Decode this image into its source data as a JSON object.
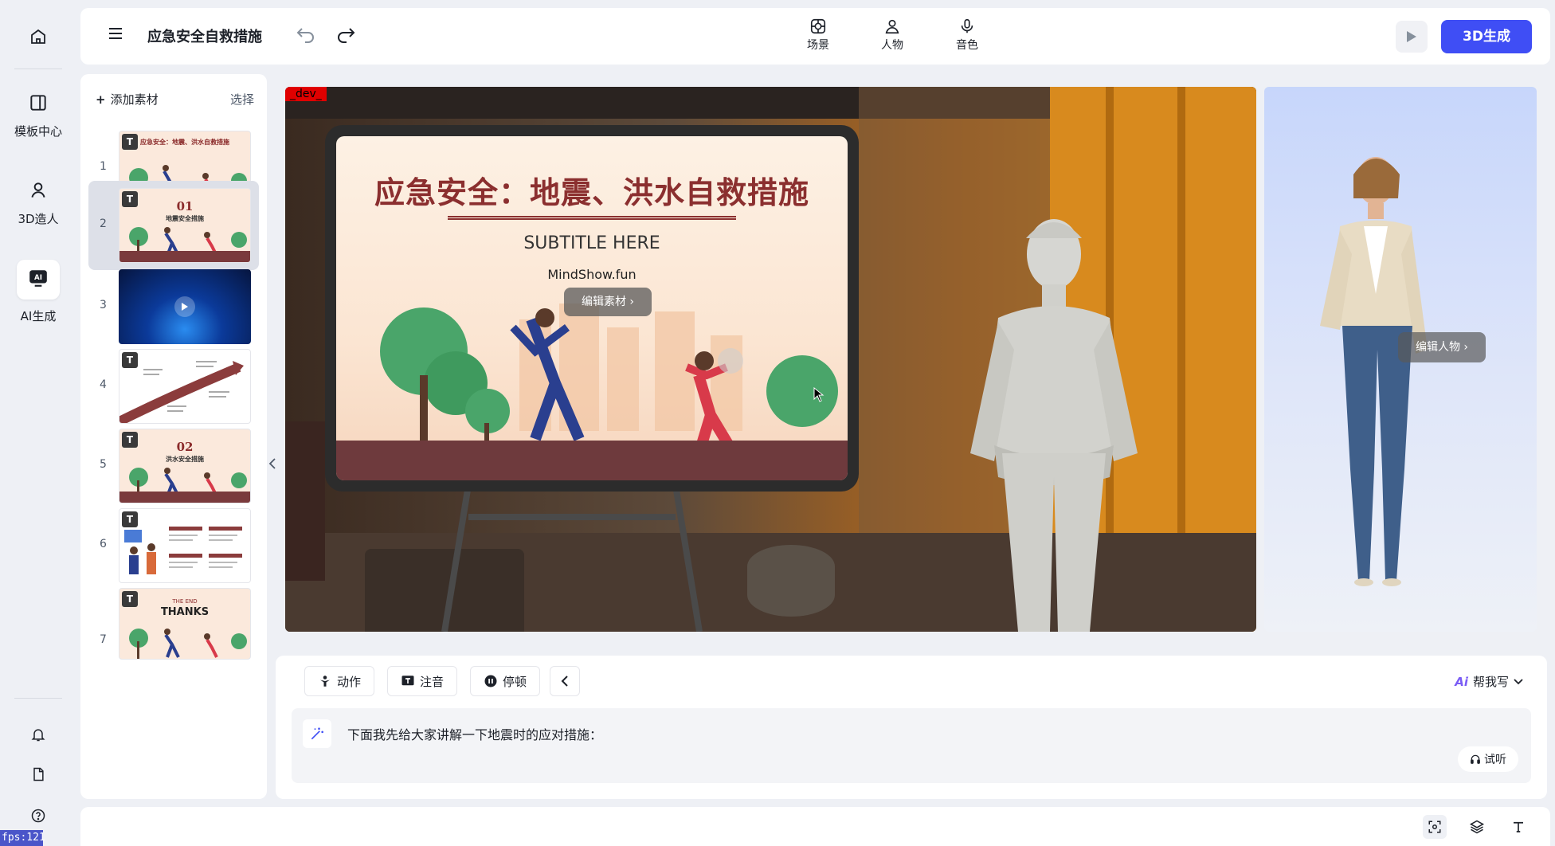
{
  "nav": {
    "items": [
      {
        "label": "",
        "icon": "home-icon"
      },
      {
        "label": "模板中心",
        "icon": "template-icon"
      },
      {
        "label": "3D造人",
        "icon": "avatar-icon"
      },
      {
        "label": "AI生成",
        "icon": "ai-icon"
      }
    ],
    "fps": "fps:121"
  },
  "header": {
    "title": "应急安全自救措施",
    "tools": [
      {
        "label": "场景",
        "icon": "scene-icon"
      },
      {
        "label": "人物",
        "icon": "person-icon"
      },
      {
        "label": "音色",
        "icon": "microphone-icon"
      }
    ],
    "generate_label": "3D生成"
  },
  "slides_panel": {
    "add_label": "添加素材",
    "select_label": "选择",
    "active_index": 2,
    "slides": [
      {
        "number": "1",
        "badge": "T",
        "title": "应急安全：地震、洪水自救措施",
        "kind": "cover"
      },
      {
        "number": "2",
        "badge": "T",
        "title": "01",
        "subtitle": "地震安全措施",
        "kind": "section"
      },
      {
        "number": "3",
        "badge": "",
        "title": "",
        "kind": "video"
      },
      {
        "number": "4",
        "badge": "T",
        "title": "",
        "kind": "diagram"
      },
      {
        "number": "5",
        "badge": "T",
        "title": "02",
        "subtitle": "洪水安全措施",
        "kind": "section"
      },
      {
        "number": "6",
        "badge": "T",
        "title": "",
        "kind": "table"
      },
      {
        "number": "7",
        "badge": "T",
        "title": "THANKS",
        "subtitle": "THE END",
        "kind": "end"
      }
    ]
  },
  "stage": {
    "dev_tag": "_dev_",
    "slide_title": "应急安全：地震、洪水自救措施",
    "slide_subtitle": "SUBTITLE HERE",
    "slide_brand": "MindShow.fun",
    "edit_material_label": "编辑素材"
  },
  "character": {
    "edit_label": "编辑人物"
  },
  "editor": {
    "chips": [
      "动作",
      "注音",
      "停顿"
    ],
    "help_write_label": "帮我写",
    "help_write_ai": "Ai",
    "script_text": "下面我先给大家讲解一下地震时的应对措施：",
    "listen_label": "试听"
  },
  "colors": {
    "accent": "#3f4ef5",
    "slide_title": "#8b2f2f",
    "background": "#eef0f5"
  }
}
